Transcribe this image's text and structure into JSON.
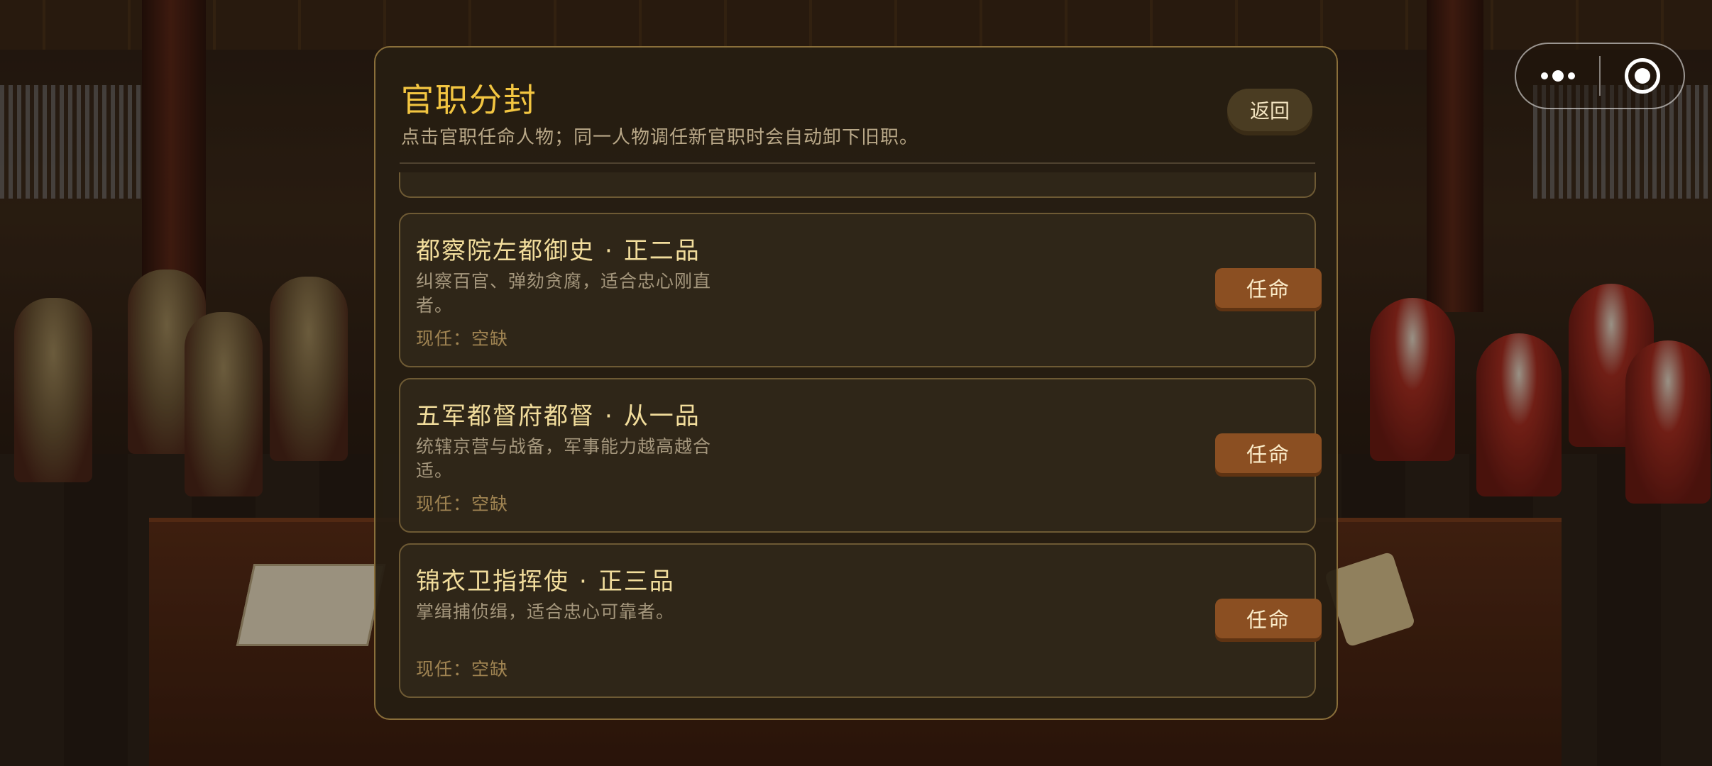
{
  "panel": {
    "title": "官职分封",
    "subtitle": "点击官职任命人物；同一人物调任新官职时会自动卸下旧职。",
    "back_label": "返回"
  },
  "positions": [
    {
      "name": "都察院左都御史",
      "separator": "·",
      "rank": "正二品",
      "description": "纠察百官、弹劾贪腐，适合忠心刚直者。",
      "current": "现任：空缺",
      "button_label": "任命"
    },
    {
      "name": "五军都督府都督",
      "separator": "·",
      "rank": "从一品",
      "description": "统辖京营与战备，军事能力越高越合适。",
      "current": "现任：空缺",
      "button_label": "任命"
    },
    {
      "name": "锦衣卫指挥使",
      "separator": "·",
      "rank": "正三品",
      "description": "掌缉捕侦缉，适合忠心可靠者。",
      "current": "现任：空缺",
      "button_label": "任命"
    }
  ],
  "capsule": {
    "more_icon": "more-dots-icon",
    "close_icon": "target-circle-icon"
  },
  "colors": {
    "title": "#f2c541",
    "accent_button": "#8b4f22",
    "panel_border": "#8a6f3a"
  }
}
